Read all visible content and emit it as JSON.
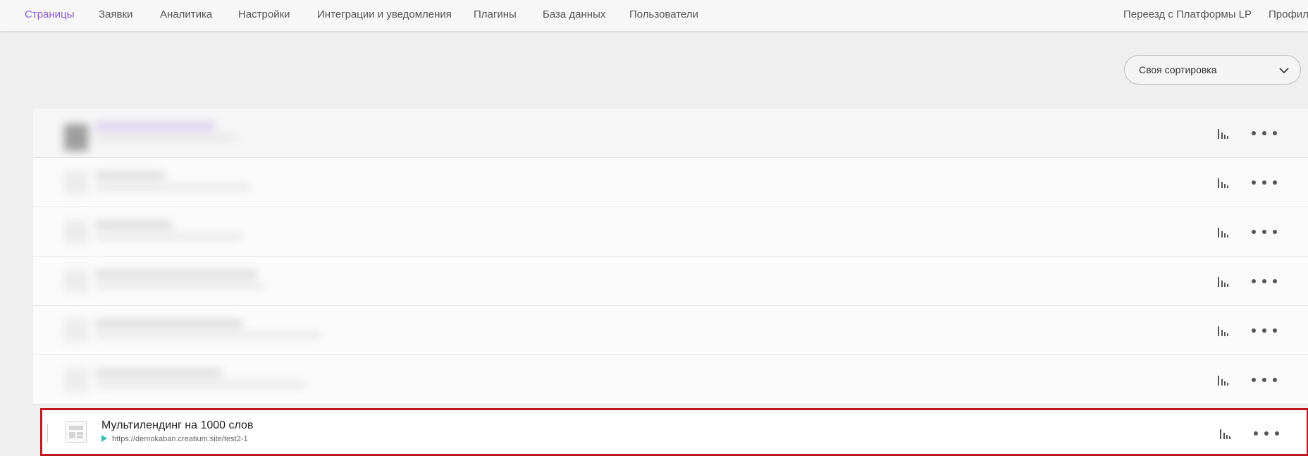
{
  "nav": {
    "items": [
      {
        "label": "Страницы",
        "active": true
      },
      {
        "label": "Заявки"
      },
      {
        "label": "Аналитика"
      },
      {
        "label": "Настройки"
      },
      {
        "label": "Интеграции и уведомления"
      },
      {
        "label": "Плагины"
      },
      {
        "label": "База данных"
      },
      {
        "label": "Пользователи"
      }
    ],
    "right_items": [
      {
        "label": "Переезд с Платформы LP"
      },
      {
        "label": "Профиль"
      }
    ]
  },
  "sort": {
    "value": "Своя сортировка",
    "icon": "chevron-down-icon"
  },
  "pages": {
    "blurred_rows": 6,
    "selected_page": {
      "title": "Мультилендинг на 1000 слов",
      "url": "https://demokaban.creatium.site/test2-1"
    },
    "row_actions": {
      "stats_icon": "bar-chart-icon",
      "more_icon": "more-dots-icon"
    }
  },
  "colors": {
    "active_nav": "#8b5cd0",
    "highlight_border": "#c0171e",
    "play_icon": "#2ec2b0"
  }
}
